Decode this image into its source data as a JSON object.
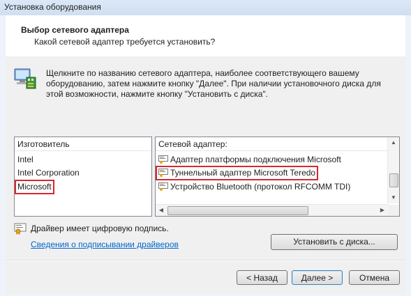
{
  "window": {
    "title": "Установка оборудования"
  },
  "header": {
    "title": "Выбор сетевого адаптера",
    "subtitle": "Какой сетевой адаптер требуется установить?"
  },
  "intro": {
    "text": "Щелкните по названию сетевого адаптера, наиболее соответствующего вашему оборудованию, затем нажмите кнопку \"Далее\". При наличии установочного диска для этой возможности, нажмите кнопку \"Установить с диска\"."
  },
  "manufacturers": {
    "header": "Изготовитель",
    "items": [
      "Intel",
      "Intel Corporation",
      "Microsoft"
    ],
    "selected": "Microsoft"
  },
  "adapters": {
    "header": "Сетевой адаптер:",
    "items": [
      "Адаптер платформы подключения Microsoft",
      "Туннельный адаптер Microsoft Teredo",
      "Устройство Bluetooth (протокол RFCOMM TDI)"
    ],
    "selected": "Туннельный адаптер Microsoft Teredo"
  },
  "driver": {
    "signed_text": "Драйвер имеет цифровую подпись.",
    "link": "Сведения о подписывании драйверов"
  },
  "buttons": {
    "have_disk": "Установить с диска...",
    "back": "< Назад",
    "next": "Далее >",
    "cancel": "Отмена"
  },
  "colors": {
    "highlight": "#d9262f",
    "link": "#0066cc"
  }
}
